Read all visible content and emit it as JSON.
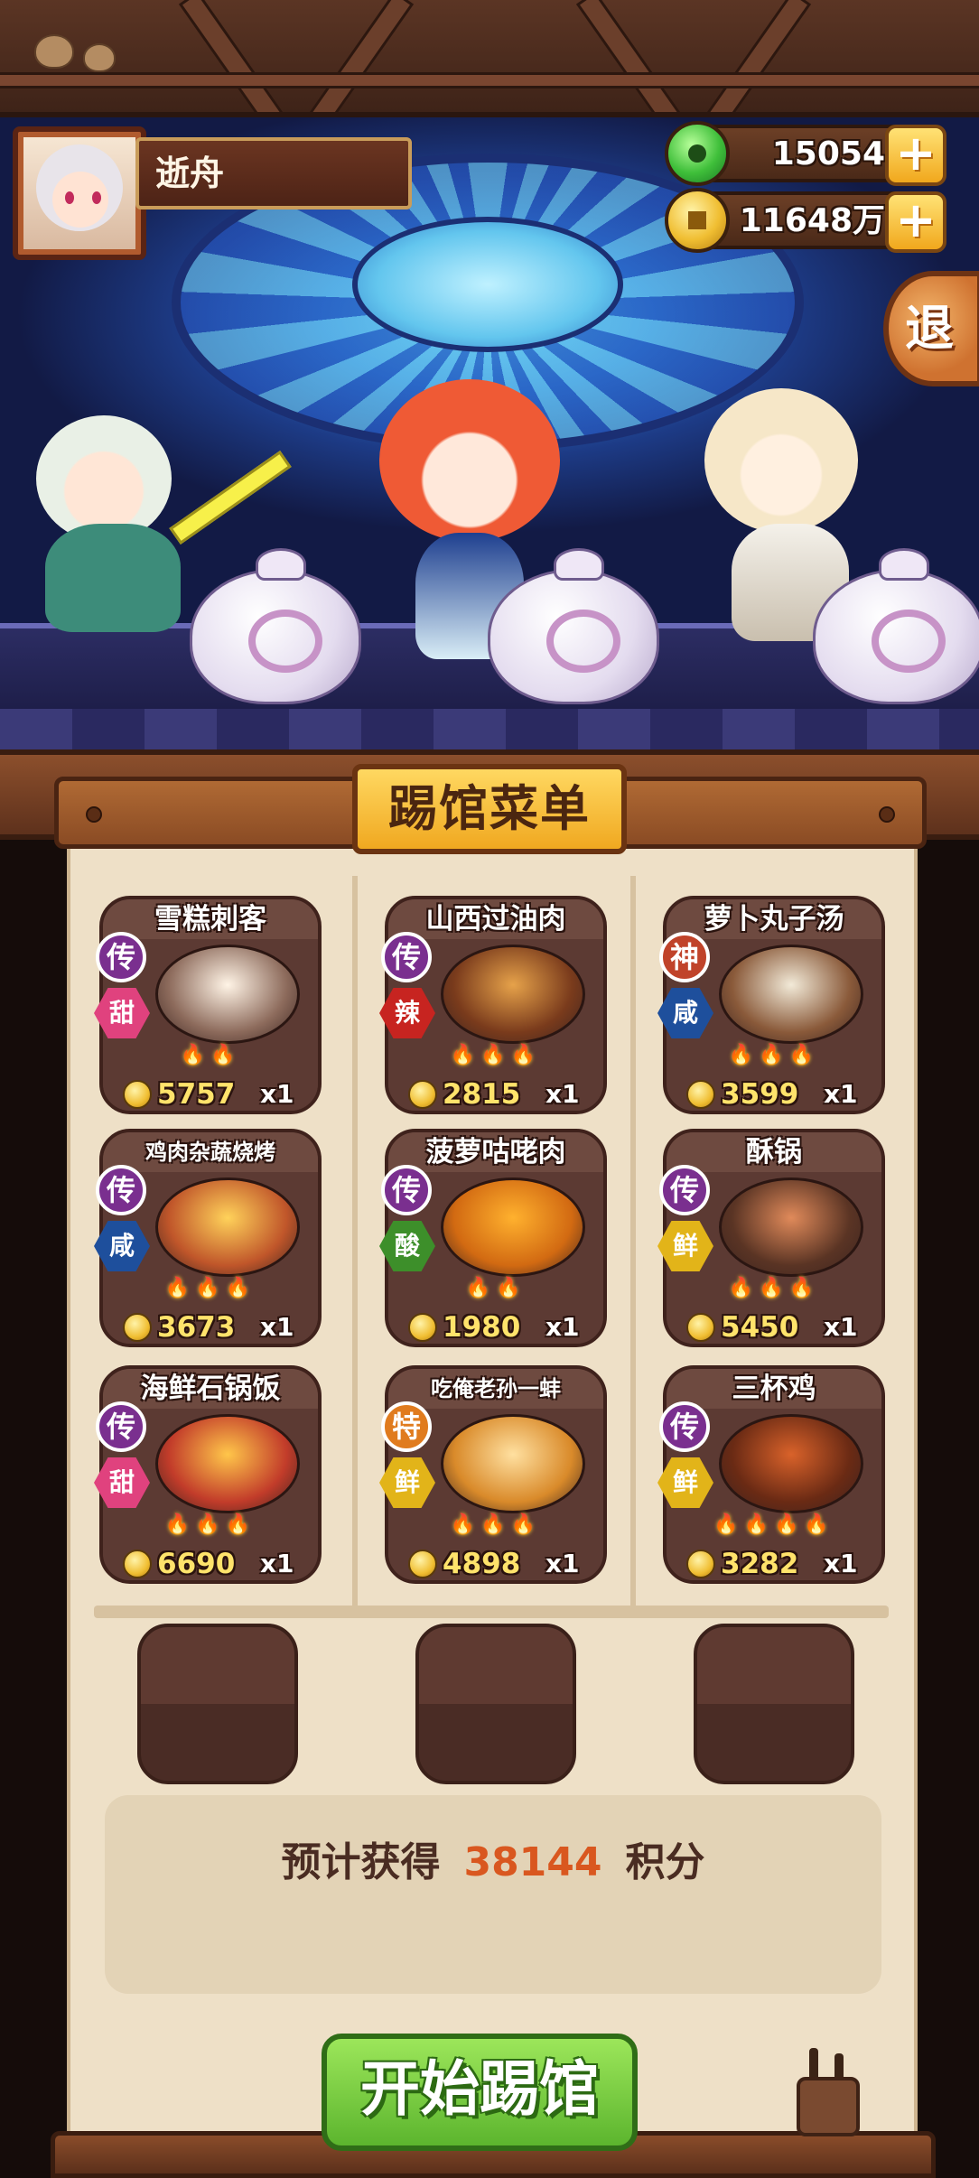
{
  "player": {
    "name": "逝舟"
  },
  "currency": {
    "jade": {
      "value": "15054",
      "icon": "jade-coin-icon"
    },
    "gold": {
      "value": "11648万",
      "icon": "gold-coin-icon"
    },
    "plus_label": "+"
  },
  "exit_label": "退",
  "menu_title": "踢馆菜单",
  "dishes": [
    {
      "name": "雪糕刺客",
      "rank": "传",
      "taste": "甜",
      "flames": "🔥🔥",
      "price": "5757",
      "qty": "x1"
    },
    {
      "name": "山西过油肉",
      "rank": "传",
      "taste": "辣",
      "flames": "🔥🔥🔥",
      "price": "2815",
      "qty": "x1"
    },
    {
      "name": "萝卜丸子汤",
      "rank": "神",
      "taste": "咸",
      "flames": "🔥🔥🔥",
      "price": "3599",
      "qty": "x1"
    },
    {
      "name": "鸡肉杂蔬烧烤",
      "rank": "传",
      "taste": "咸",
      "flames": "🔥🔥🔥",
      "price": "3673",
      "qty": "x1"
    },
    {
      "name": "菠萝咕咾肉",
      "rank": "传",
      "taste": "酸",
      "flames": "🔥🔥",
      "price": "1980",
      "qty": "x1"
    },
    {
      "name": "酥锅",
      "rank": "传",
      "taste": "鲜",
      "flames": "🔥🔥🔥",
      "price": "5450",
      "qty": "x1"
    },
    {
      "name": "海鲜石锅饭",
      "rank": "传",
      "taste": "甜",
      "flames": "🔥🔥🔥",
      "price": "6690",
      "qty": "x1"
    },
    {
      "name": "吃俺老孙一蚌",
      "rank": "特",
      "taste": "鲜",
      "flames": "🔥🔥🔥",
      "price": "4898",
      "qty": "x1"
    },
    {
      "name": "三杯鸡",
      "rank": "传",
      "taste": "鲜",
      "flames": "🔥🔥🔥🔥",
      "price": "3282",
      "qty": "x1"
    }
  ],
  "estimate": {
    "prefix": "预计获得",
    "value": "38144",
    "suffix": "积分"
  },
  "start_button": "开始踢馆",
  "colors": {
    "accent_gold": "#f0a820",
    "start_green": "#5cb52e",
    "score_orange": "#d9571f"
  }
}
